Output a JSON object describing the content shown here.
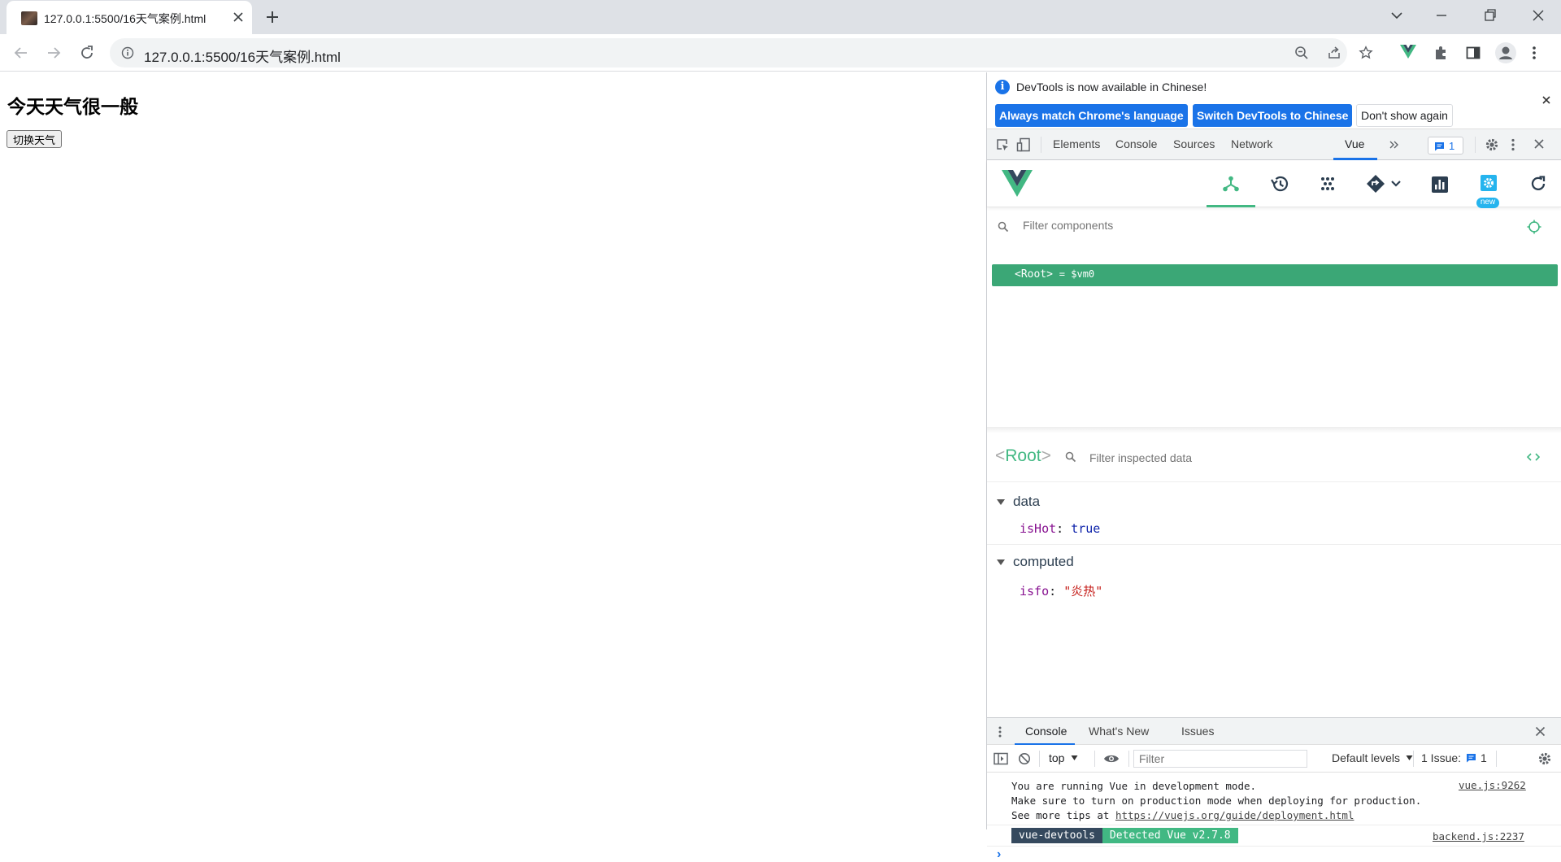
{
  "browser": {
    "tab_title": "127.0.0.1:5500/16天气案例.html",
    "url": "127.0.0.1:5500/16天气案例.html"
  },
  "page": {
    "heading": "今天天气很一般",
    "switch_button": "切换天气"
  },
  "devtools": {
    "infobar": {
      "message": "DevTools is now available in Chinese!",
      "match_language": "Always match Chrome's language",
      "switch_chinese": "Switch DevTools to Chinese",
      "dont_show": "Don't show again"
    },
    "tabs": [
      "Elements",
      "Console",
      "Sources",
      "Network",
      "Vue"
    ],
    "active_tab": "Vue",
    "message_count": "1",
    "vue": {
      "new_badge": "new",
      "filter_components_placeholder": "Filter components",
      "root_component": "<Root>",
      "root_ref": "= $vm0",
      "inspector_name_open": "<",
      "inspector_name": "Root",
      "inspector_name_close": ">",
      "filter_inspected_placeholder": "Filter inspected data",
      "data_section": "data",
      "data_key": "isHot",
      "data_value": "true",
      "computed_section": "computed",
      "computed_key": "isfo",
      "computed_value": "\"炎热\""
    },
    "drawer": {
      "tabs": [
        "Console",
        "What's New",
        "Issues"
      ],
      "active_tab": "Console",
      "context": "top",
      "filter_placeholder": "Filter",
      "levels": "Default levels",
      "issues_label": "1 Issue:",
      "issues_count": "1"
    },
    "console": {
      "msg1_line1": "You are running Vue in development mode.",
      "msg1_line2": "Make sure to turn on production mode when deploying for production.",
      "msg1_line3_prefix": "See more tips at ",
      "msg1_link": "https://vuejs.org/guide/deployment.html",
      "msg1_source": "vue.js:9262",
      "devtools_tag": "vue-devtools",
      "detected_tag": "Detected Vue v2.7.8",
      "msg2_source": "backend.js:2237",
      "prompt": "›"
    }
  },
  "colors": {
    "vue_green": "#42b883",
    "vue_dark": "#35495e",
    "chrome_blue": "#1a73e8",
    "tab_strip": "#dee1e6"
  }
}
